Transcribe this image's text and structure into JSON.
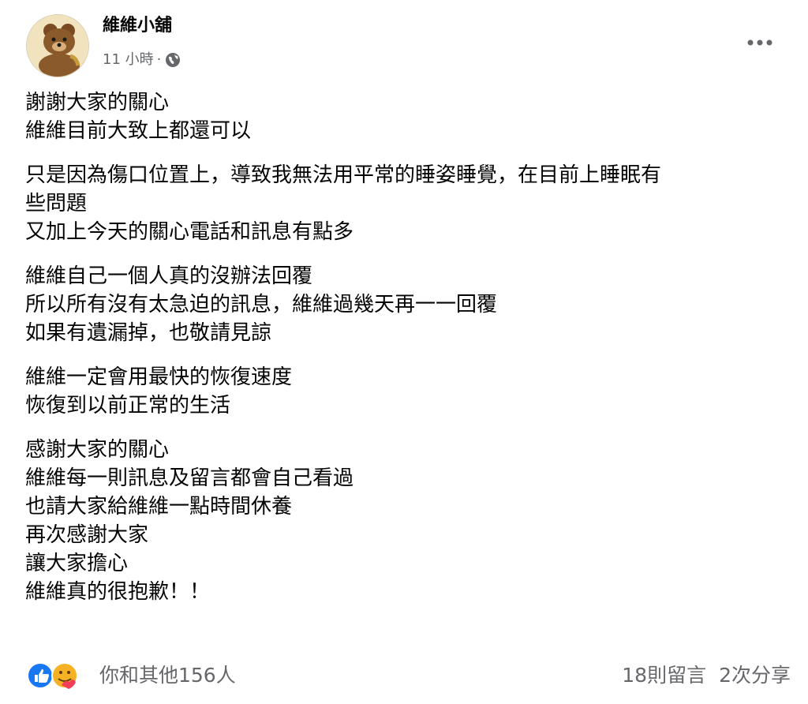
{
  "post": {
    "author": "維維小舖",
    "avatar_text": "維維小舖",
    "time": "11 小時",
    "separator": "·",
    "audience_icon": "globe-icon",
    "more_icon": "more-horizontal-icon",
    "paragraphs": [
      [
        "謝謝大家的關心",
        "維維目前大致上都還可以"
      ],
      [
        "只是因為傷口位置上，導致我無法用平常的睡姿睡覺，在目前上睡眠有",
        "些問題",
        "又加上今天的關心電話和訊息有點多"
      ],
      [
        "維維自己一個人真的沒辦法回覆",
        "所以所有沒有太急迫的訊息，維維過幾天再一一回覆",
        "如果有遺漏掉，也敬請見諒"
      ],
      [
        "維維一定會用最快的恢復速度",
        "恢復到以前正常的生活"
      ],
      [
        "感謝大家的關心",
        "維維每一則訊息及留言都會自己看過",
        "也請大家給維維一點時間休養",
        "再次感謝大家",
        "讓大家擔心",
        "維維真的很抱歉！！"
      ]
    ]
  },
  "footer": {
    "reactions": [
      "like-icon",
      "care-icon"
    ],
    "reaction_text": "你和其他156人",
    "comments": "18則留言",
    "shares": "2次分享"
  },
  "colors": {
    "primary_text": "#050505",
    "secondary_text": "#65676b",
    "like_blue": "#1877f2",
    "care_yellow": "#f7b125"
  }
}
